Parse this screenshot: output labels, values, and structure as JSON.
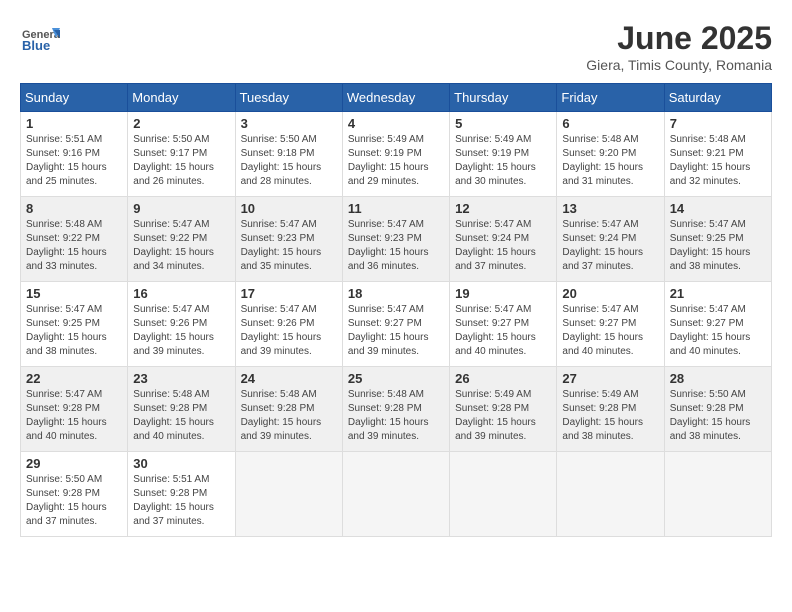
{
  "logo": {
    "line1": "General",
    "line2": "Blue"
  },
  "title": "June 2025",
  "subtitle": "Giera, Timis County, Romania",
  "headers": [
    "Sunday",
    "Monday",
    "Tuesday",
    "Wednesday",
    "Thursday",
    "Friday",
    "Saturday"
  ],
  "weeks": [
    [
      {
        "day": "1",
        "info": "Sunrise: 5:51 AM\nSunset: 9:16 PM\nDaylight: 15 hours\nand 25 minutes."
      },
      {
        "day": "2",
        "info": "Sunrise: 5:50 AM\nSunset: 9:17 PM\nDaylight: 15 hours\nand 26 minutes."
      },
      {
        "day": "3",
        "info": "Sunrise: 5:50 AM\nSunset: 9:18 PM\nDaylight: 15 hours\nand 28 minutes."
      },
      {
        "day": "4",
        "info": "Sunrise: 5:49 AM\nSunset: 9:19 PM\nDaylight: 15 hours\nand 29 minutes."
      },
      {
        "day": "5",
        "info": "Sunrise: 5:49 AM\nSunset: 9:19 PM\nDaylight: 15 hours\nand 30 minutes."
      },
      {
        "day": "6",
        "info": "Sunrise: 5:48 AM\nSunset: 9:20 PM\nDaylight: 15 hours\nand 31 minutes."
      },
      {
        "day": "7",
        "info": "Sunrise: 5:48 AM\nSunset: 9:21 PM\nDaylight: 15 hours\nand 32 minutes."
      }
    ],
    [
      {
        "day": "8",
        "info": "Sunrise: 5:48 AM\nSunset: 9:22 PM\nDaylight: 15 hours\nand 33 minutes."
      },
      {
        "day": "9",
        "info": "Sunrise: 5:47 AM\nSunset: 9:22 PM\nDaylight: 15 hours\nand 34 minutes."
      },
      {
        "day": "10",
        "info": "Sunrise: 5:47 AM\nSunset: 9:23 PM\nDaylight: 15 hours\nand 35 minutes."
      },
      {
        "day": "11",
        "info": "Sunrise: 5:47 AM\nSunset: 9:23 PM\nDaylight: 15 hours\nand 36 minutes."
      },
      {
        "day": "12",
        "info": "Sunrise: 5:47 AM\nSunset: 9:24 PM\nDaylight: 15 hours\nand 37 minutes."
      },
      {
        "day": "13",
        "info": "Sunrise: 5:47 AM\nSunset: 9:24 PM\nDaylight: 15 hours\nand 37 minutes."
      },
      {
        "day": "14",
        "info": "Sunrise: 5:47 AM\nSunset: 9:25 PM\nDaylight: 15 hours\nand 38 minutes."
      }
    ],
    [
      {
        "day": "15",
        "info": "Sunrise: 5:47 AM\nSunset: 9:25 PM\nDaylight: 15 hours\nand 38 minutes."
      },
      {
        "day": "16",
        "info": "Sunrise: 5:47 AM\nSunset: 9:26 PM\nDaylight: 15 hours\nand 39 minutes."
      },
      {
        "day": "17",
        "info": "Sunrise: 5:47 AM\nSunset: 9:26 PM\nDaylight: 15 hours\nand 39 minutes."
      },
      {
        "day": "18",
        "info": "Sunrise: 5:47 AM\nSunset: 9:27 PM\nDaylight: 15 hours\nand 39 minutes."
      },
      {
        "day": "19",
        "info": "Sunrise: 5:47 AM\nSunset: 9:27 PM\nDaylight: 15 hours\nand 40 minutes."
      },
      {
        "day": "20",
        "info": "Sunrise: 5:47 AM\nSunset: 9:27 PM\nDaylight: 15 hours\nand 40 minutes."
      },
      {
        "day": "21",
        "info": "Sunrise: 5:47 AM\nSunset: 9:27 PM\nDaylight: 15 hours\nand 40 minutes."
      }
    ],
    [
      {
        "day": "22",
        "info": "Sunrise: 5:47 AM\nSunset: 9:28 PM\nDaylight: 15 hours\nand 40 minutes."
      },
      {
        "day": "23",
        "info": "Sunrise: 5:48 AM\nSunset: 9:28 PM\nDaylight: 15 hours\nand 40 minutes."
      },
      {
        "day": "24",
        "info": "Sunrise: 5:48 AM\nSunset: 9:28 PM\nDaylight: 15 hours\nand 39 minutes."
      },
      {
        "day": "25",
        "info": "Sunrise: 5:48 AM\nSunset: 9:28 PM\nDaylight: 15 hours\nand 39 minutes."
      },
      {
        "day": "26",
        "info": "Sunrise: 5:49 AM\nSunset: 9:28 PM\nDaylight: 15 hours\nand 39 minutes."
      },
      {
        "day": "27",
        "info": "Sunrise: 5:49 AM\nSunset: 9:28 PM\nDaylight: 15 hours\nand 38 minutes."
      },
      {
        "day": "28",
        "info": "Sunrise: 5:50 AM\nSunset: 9:28 PM\nDaylight: 15 hours\nand 38 minutes."
      }
    ],
    [
      {
        "day": "29",
        "info": "Sunrise: 5:50 AM\nSunset: 9:28 PM\nDaylight: 15 hours\nand 37 minutes."
      },
      {
        "day": "30",
        "info": "Sunrise: 5:51 AM\nSunset: 9:28 PM\nDaylight: 15 hours\nand 37 minutes."
      },
      null,
      null,
      null,
      null,
      null
    ]
  ]
}
